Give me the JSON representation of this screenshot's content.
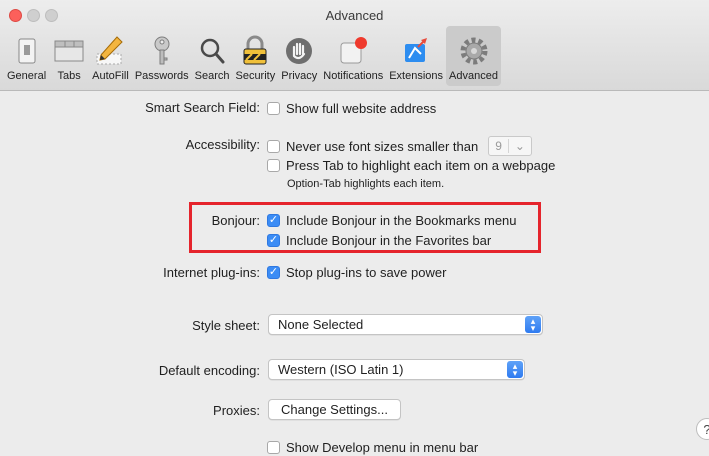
{
  "window": {
    "title": "Advanced"
  },
  "toolbar": {
    "items": [
      {
        "label": "General",
        "icon": "general-switch-icon"
      },
      {
        "label": "Tabs",
        "icon": "tabs-icon"
      },
      {
        "label": "AutoFill",
        "icon": "pencil-icon"
      },
      {
        "label": "Passwords",
        "icon": "key-icon"
      },
      {
        "label": "Search",
        "icon": "magnifier-icon"
      },
      {
        "label": "Security",
        "icon": "lock-icon"
      },
      {
        "label": "Privacy",
        "icon": "hand-icon"
      },
      {
        "label": "Notifications",
        "icon": "notification-icon"
      },
      {
        "label": "Extensions",
        "icon": "puzzle-icon"
      },
      {
        "label": "Advanced",
        "icon": "gear-icon",
        "selected": true
      }
    ]
  },
  "settings": {
    "smart_search": {
      "label": "Smart Search Field:",
      "option": "Show full website address",
      "checked": false
    },
    "accessibility": {
      "label": "Accessibility:",
      "font_option": "Never use font sizes smaller than",
      "font_value": "9",
      "font_checked": false,
      "tab_option": "Press Tab to highlight each item on a webpage",
      "tab_checked": false,
      "note": "Option-Tab highlights each item."
    },
    "bonjour": {
      "label": "Bonjour:",
      "bookmarks_option": "Include Bonjour in the Bookmarks menu",
      "bookmarks_checked": true,
      "favorites_option": "Include Bonjour in the Favorites bar",
      "favorites_checked": true
    },
    "plugins": {
      "label": "Internet plug-ins:",
      "option": "Stop plug-ins to save power",
      "checked": true
    },
    "stylesheet": {
      "label": "Style sheet:",
      "value": "None Selected"
    },
    "encoding": {
      "label": "Default encoding:",
      "value": "Western (ISO Latin 1)"
    },
    "proxies": {
      "label": "Proxies:",
      "button": "Change Settings..."
    },
    "develop": {
      "option": "Show Develop menu in menu bar",
      "checked": false
    }
  },
  "help": {
    "label": "?"
  },
  "colors": {
    "accent": "#3b8cf5",
    "highlight_box": "#e5242c"
  }
}
